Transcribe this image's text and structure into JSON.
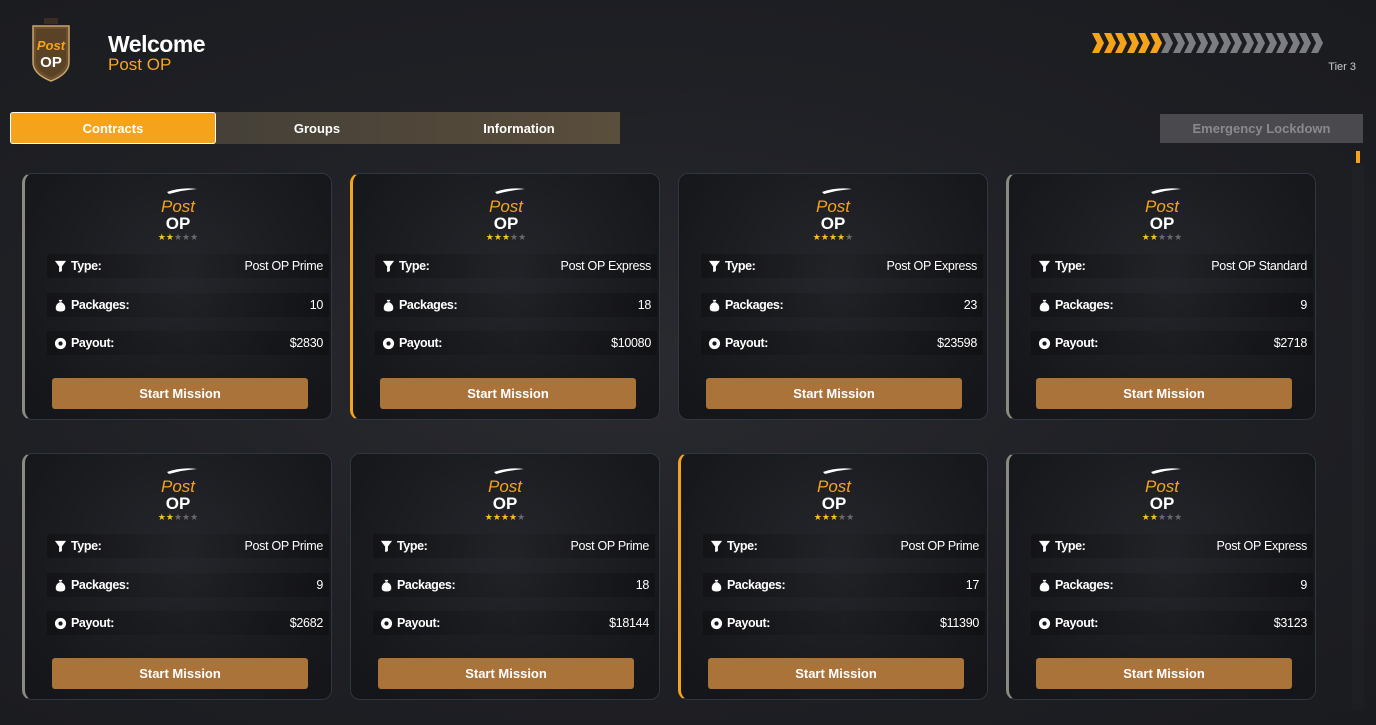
{
  "header": {
    "welcome_title": "Welcome",
    "welcome_sub": "Post OP",
    "tier_label": "Tier 3",
    "tier_progress": {
      "filled": 6,
      "total": 20
    },
    "logo_text_top": "Post",
    "logo_text_bottom": "OP"
  },
  "tabs": [
    {
      "label": "Contracts",
      "active": true
    },
    {
      "label": "Groups",
      "active": false
    },
    {
      "label": "Information",
      "active": false
    }
  ],
  "emergency_button": "Emergency Lockdown",
  "labels": {
    "type": "Type:",
    "packages": "Packages:",
    "payout": "Payout:",
    "start": "Start Mission"
  },
  "colors": {
    "accent": "#f5a31a",
    "button": "#a9733a",
    "star": "#f5c21b",
    "edge_grey": "#8a8a80"
  },
  "cards": [
    {
      "type": "Post OP Prime",
      "packages": "10",
      "payout": "$2830",
      "stars": 1.5,
      "edge": "grey"
    },
    {
      "type": "Post OP Express",
      "packages": "18",
      "payout": "$10080",
      "stars": 2.5,
      "edge": "orange"
    },
    {
      "type": "Post OP Express",
      "packages": "23",
      "payout": "$23598",
      "stars": 4,
      "edge": "none"
    },
    {
      "type": "Post OP Standard",
      "packages": "9",
      "payout": "$2718",
      "stars": 1.5,
      "edge": "grey"
    },
    {
      "type": "Post OP Prime",
      "packages": "9",
      "payout": "$2682",
      "stars": 1.5,
      "edge": "grey"
    },
    {
      "type": "Post OP Prime",
      "packages": "18",
      "payout": "$18144",
      "stars": 4,
      "edge": "none"
    },
    {
      "type": "Post OP Prime",
      "packages": "17",
      "payout": "$11390",
      "stars": 2.5,
      "edge": "orange"
    },
    {
      "type": "Post OP Express",
      "packages": "9",
      "payout": "$3123",
      "stars": 1.5,
      "edge": "grey"
    }
  ]
}
